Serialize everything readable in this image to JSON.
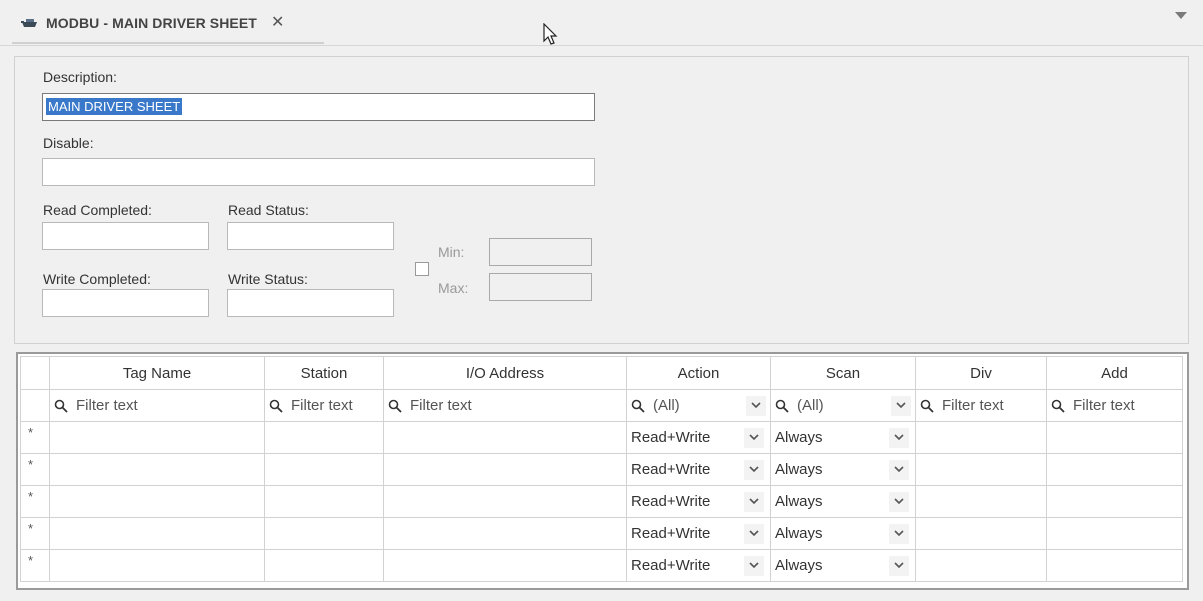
{
  "tab": {
    "title": "MODBU - MAIN DRIVER SHEET",
    "close_glyph": "✕"
  },
  "form": {
    "description_label": "Description:",
    "description_value": "MAIN DRIVER SHEET",
    "disable_label": "Disable:",
    "read_completed_label": "Read Completed:",
    "read_status_label": "Read Status:",
    "write_completed_label": "Write Completed:",
    "write_status_label": "Write Status:",
    "min_label": "Min:",
    "max_label": "Max:"
  },
  "grid": {
    "columns": [
      "Tag Name",
      "Station",
      "I/O Address",
      "Action",
      "Scan",
      "Div",
      "Add"
    ],
    "filter_placeholder": "Filter text",
    "filter_all": "(All)",
    "new_row_marker": "*",
    "rows": [
      {
        "action": "Read+Write",
        "scan": "Always"
      },
      {
        "action": "Read+Write",
        "scan": "Always"
      },
      {
        "action": "Read+Write",
        "scan": "Always"
      },
      {
        "action": "Read+Write",
        "scan": "Always"
      },
      {
        "action": "Read+Write",
        "scan": "Always"
      }
    ]
  },
  "colors": {
    "selection": "#3a78c9",
    "border": "#d2d2d2"
  }
}
